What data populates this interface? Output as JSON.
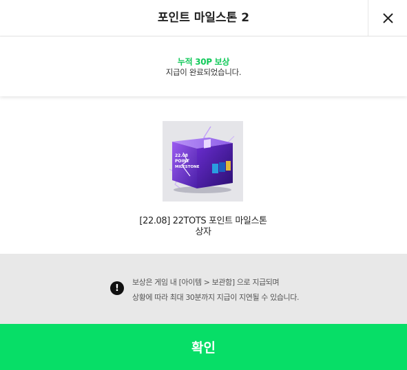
{
  "header": {
    "title": "포인트 마일스톤 2",
    "close_icon": "close-icon"
  },
  "status": {
    "title": "누적 30P 보상",
    "description": "지급이 완료되었습니다."
  },
  "reward": {
    "image_icon": "milestone-box-image",
    "box_text_line1": "22.08",
    "box_text_line2": "POINT",
    "box_text_line3": "MILESTONE",
    "name_line1": "[22.08] 22TOTS 포인트 마일스톤",
    "name_line2": "상자"
  },
  "notice": {
    "icon": "exclamation-icon",
    "line1": "보상은 게임 내 [아이템 > 보관함] 으로 지급되며",
    "line2": "상황에 따라 최대 30분까지 지급이 지연될 수 있습니다."
  },
  "confirm": {
    "label": "확인"
  },
  "colors": {
    "accent_green": "#07de67",
    "status_green": "#12c95a",
    "notice_bg": "#e8e8e8"
  }
}
